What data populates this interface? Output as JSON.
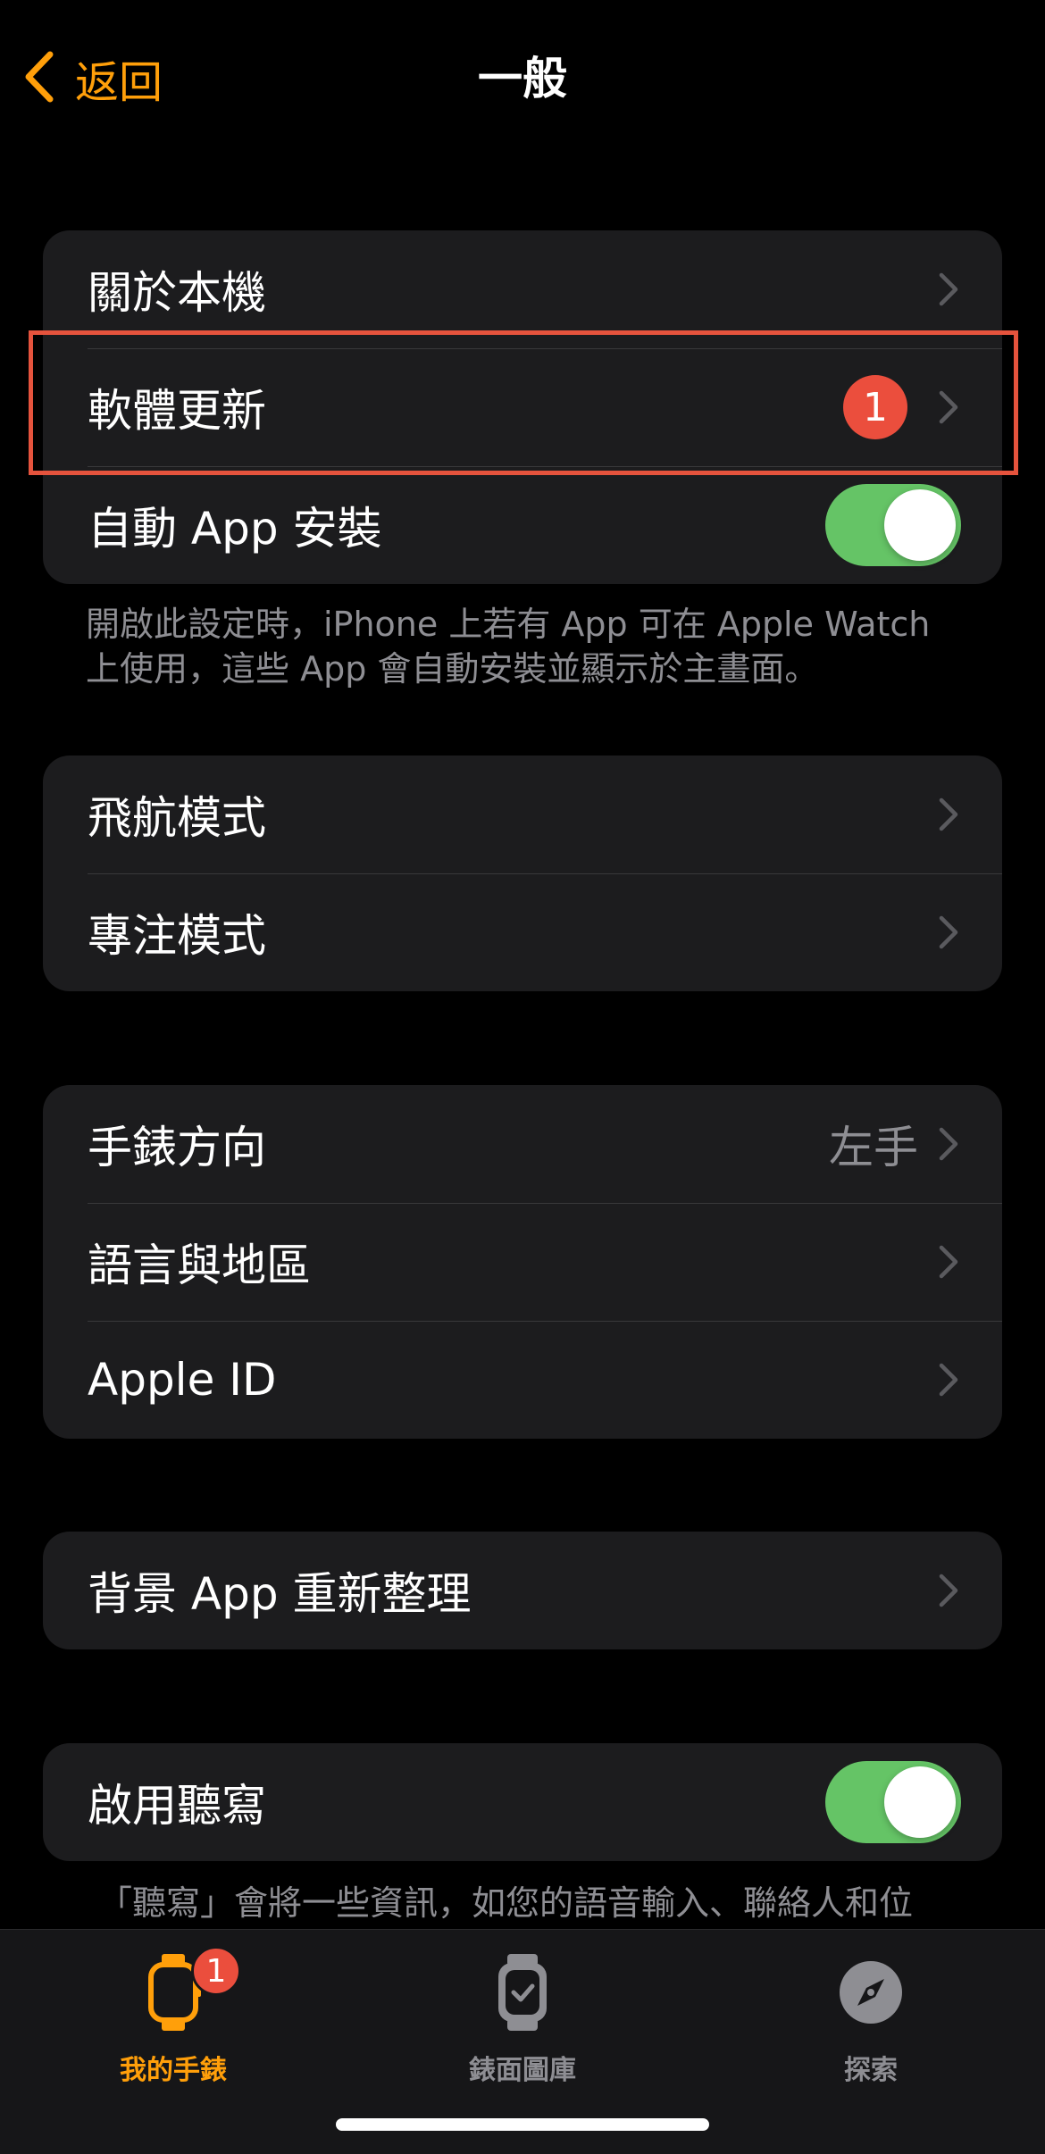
{
  "nav": {
    "back_label": "返回",
    "title": "一般"
  },
  "group1": {
    "about": "關於本機",
    "software_update": "軟體更新",
    "software_update_badge": "1",
    "auto_install": "自動 App 安裝",
    "auto_install_on": true
  },
  "footnote1": "開啟此設定時，iPhone 上若有 App 可在 Apple Watch 上使用，這些 App 會自動安裝並顯示於主畫面。",
  "group2": {
    "airplane": "飛航模式",
    "focus": "專注模式"
  },
  "group3": {
    "orientation": "手錶方向",
    "orientation_value": "左手",
    "language": "語言與地區",
    "apple_id": "Apple ID"
  },
  "group4": {
    "background_refresh": "背景 App 重新整理"
  },
  "group5": {
    "dictation": "啟用聽寫",
    "dictation_on": true
  },
  "footnote2": "「聽寫」會將一些資訊，如您的語音輸入、聯絡人和位",
  "tabbar": {
    "my_watch": "我的手錶",
    "my_watch_badge": "1",
    "face_gallery": "錶面圖庫",
    "discover": "探索"
  },
  "colors": {
    "accent": "#ff9f0a",
    "toggle_on": "#65c466",
    "badge": "#eb4e3d",
    "highlight_box": "#e5533d"
  }
}
